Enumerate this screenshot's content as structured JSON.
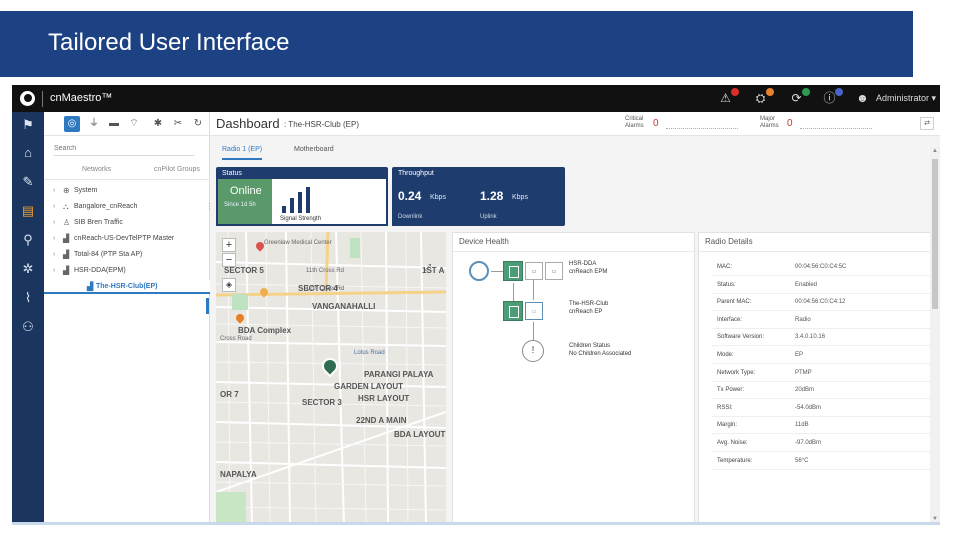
{
  "slide": {
    "title": "Tailored User Interface"
  },
  "app": {
    "brand": "cnMaestro™",
    "admin": "Administrator",
    "top_icons": [
      {
        "icon": "alarm-icon",
        "color": "#d9302c"
      },
      {
        "icon": "alert-icon",
        "color": "#e8822a"
      },
      {
        "icon": "update-icon",
        "color": "#2e9a52"
      },
      {
        "icon": "info-icon",
        "color": "#4a63c7"
      }
    ]
  },
  "rail": {
    "items": [
      "home-icon",
      "tools-icon",
      "report-icon",
      "wireless-icon",
      "settings-icon",
      "antenna-icon",
      "user-icon"
    ],
    "active_index": 2
  },
  "tree": {
    "search_placeholder": "Search",
    "tabs": [
      "Networks",
      "cnPilot Groups"
    ],
    "rows": [
      {
        "label": "System",
        "icon": "globe-icon",
        "chev": "‹",
        "more": ""
      },
      {
        "label": "Bangalore_cnReach",
        "icon": "network-icon",
        "chev": "‹",
        "more": "⋮"
      },
      {
        "label": "SIB Bren Traffic",
        "icon": "person-icon",
        "chev": "‹",
        "more": ""
      },
      {
        "label": "cnReach-US-DevTelPTP Master",
        "icon": "radio-icon",
        "chev": "‹",
        "more": ""
      },
      {
        "label": "Total-84 (PTP Sta AP)",
        "icon": "radio-icon",
        "chev": "‹",
        "more": ""
      },
      {
        "label": "HSR-DDA(EPM)",
        "icon": "radio-icon",
        "chev": "‹",
        "more": ""
      },
      {
        "label": "The-HSR-Club(EP)",
        "icon": "radio-icon",
        "chev": "",
        "more": ""
      }
    ],
    "selected_index": 6
  },
  "dashboard": {
    "title": "Dashboard",
    "subtitle": ": The-HSR-Club (EP)",
    "alarms": [
      {
        "label": "Critical Alarms",
        "value": "0"
      },
      {
        "label": "Major Alarms",
        "value": "0"
      }
    ],
    "tabs": [
      "Radio 1 (EP)",
      "Motherboard"
    ],
    "status": {
      "header": "Status",
      "state": "Online",
      "since": "Since 1d 5h",
      "signal_caption": "Signal Strength"
    },
    "throughput": {
      "header": "Throughput",
      "down_value": "0.24",
      "down_unit": "Kbps",
      "down_label": "Downlink",
      "up_value": "1.28",
      "up_unit": "Kbps",
      "up_label": "Uplink"
    },
    "map": {
      "labels": [
        {
          "text": "Greenlaw Medical Center",
          "cls": "small"
        },
        {
          "text": "SECTOR 5",
          "cls": ""
        },
        {
          "text": "1ST A",
          "cls": ""
        },
        {
          "text": "SECTOR 4",
          "cls": ""
        },
        {
          "text": "VANGANAHALLI",
          "cls": ""
        },
        {
          "text": "BDA Complex",
          "cls": ""
        },
        {
          "text": "PARANGI PALAYA",
          "cls": ""
        },
        {
          "text": "GARDEN LAYOUT",
          "cls": ""
        },
        {
          "text": "HSR LAYOUT",
          "cls": ""
        },
        {
          "text": "SECTOR 3",
          "cls": ""
        },
        {
          "text": "22ND A MAIN",
          "cls": ""
        },
        {
          "text": "BDA LAYOUT",
          "cls": ""
        },
        {
          "text": "NAPALYA",
          "cls": ""
        },
        {
          "text": "OR 7",
          "cls": ""
        },
        {
          "text": "11th Cross Rd",
          "cls": "small"
        },
        {
          "text": "12th Cross Rd",
          "cls": "small"
        },
        {
          "text": "Cross Road",
          "cls": "small"
        },
        {
          "text": "Lotus Road",
          "cls": "blue"
        }
      ]
    },
    "device_health": {
      "title": "Device Health",
      "nodes": [
        {
          "name": "HSR-DDA",
          "sub": "cnReach EPM"
        },
        {
          "name": "The-HSR-Club",
          "sub": "cnReach EP"
        },
        {
          "name": "Children Status",
          "sub": "No Children Associated"
        }
      ]
    },
    "radio_details": {
      "title": "Radio Details",
      "rows": [
        {
          "key": "MAC:",
          "value": "00:04:56:C0:C4:5C"
        },
        {
          "key": "Status:",
          "value": "Enabled"
        },
        {
          "key": "Parent MAC:",
          "value": "00:04:56:C0:C4:12"
        },
        {
          "key": "Interface:",
          "value": "Radio"
        },
        {
          "key": "Software Version:",
          "value": "3.4.0.10.16"
        },
        {
          "key": "Mode:",
          "value": "EP"
        },
        {
          "key": "Network Type:",
          "value": "PTMP"
        },
        {
          "key": "Tx Power:",
          "value": "20dBm"
        },
        {
          "key": "RSSI:",
          "value": "-54.0dBm"
        },
        {
          "key": "Margin:",
          "value": "11dB"
        },
        {
          "key": "Avg. Noise:",
          "value": "-97.0dBm"
        },
        {
          "key": "Temperature:",
          "value": "56°C"
        }
      ]
    }
  }
}
